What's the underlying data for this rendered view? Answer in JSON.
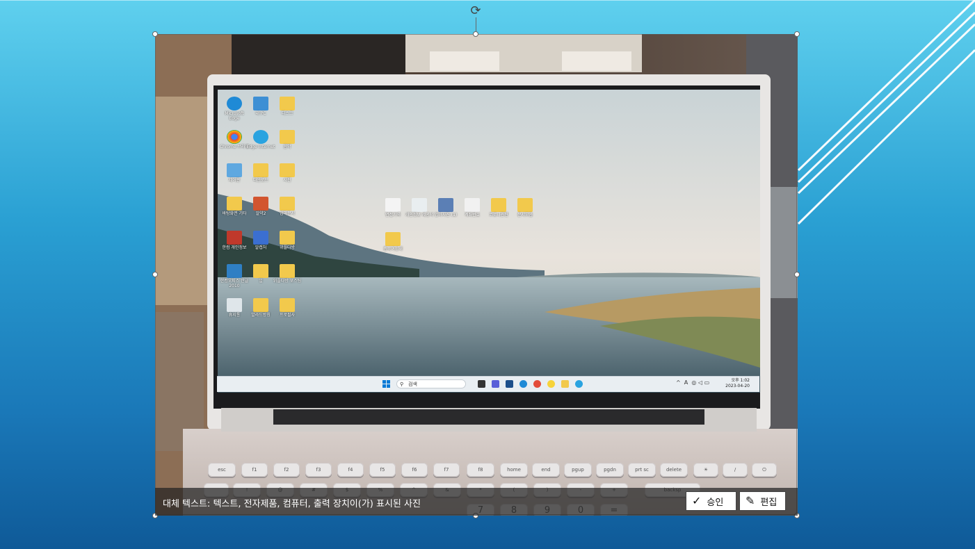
{
  "colors": {
    "slide_top": "#5fd0ee",
    "slide_bottom": "#0f5a98",
    "alt_bar": "#232323",
    "button_bg": "#ffffff"
  },
  "photo": {
    "desktop_icons": [
      {
        "label": "Microsoft Edge",
        "icon": "edge-icon"
      },
      {
        "label": "내 PC",
        "icon": "pc-icon"
      },
      {
        "label": "디스크",
        "icon": "folder-icon"
      },
      {
        "label": "Chrome 브라우",
        "icon": "chrome-icon"
      },
      {
        "label": "Edge Internet",
        "icon": "edge-icon"
      },
      {
        "label": "음악",
        "icon": "folder-icon"
      },
      {
        "label": "제어판",
        "icon": "control-icon"
      },
      {
        "label": "다운로드",
        "icon": "folder-icon"
      },
      {
        "label": "사진",
        "icon": "folder-icon"
      },
      {
        "label": "바탕화면 기타",
        "icon": "folder-icon"
      },
      {
        "label": "알약2",
        "icon": "app-icon"
      },
      {
        "label": "엄마문서",
        "icon": "folder-icon"
      },
      {
        "label": "한컴 개인정보",
        "icon": "pdf-icon"
      },
      {
        "label": "알캡처",
        "icon": "app-icon"
      },
      {
        "label": "위플다방",
        "icon": "folder-icon"
      },
      {
        "label": "한컴오피스 한글 2010",
        "icon": "hwp-icon"
      },
      {
        "label": "일",
        "icon": "folder-icon"
      },
      {
        "label": "위플다방 포스팅",
        "icon": "folder-icon"
      },
      {
        "label": "휴지통",
        "icon": "recycle-icon"
      },
      {
        "label": "발라드방칭",
        "icon": "folder-icon"
      },
      {
        "label": "프로필사",
        "icon": "folder-icon"
      }
    ],
    "center_icons": [
      {
        "label": "면접기록",
        "icon": "doc-icon"
      },
      {
        "label": "개인정보 제공서",
        "icon": "doc-icon"
      },
      {
        "label": "엄마사진 (1)",
        "icon": "photo-icon"
      },
      {
        "label": "계좌번호",
        "icon": "doc-icon"
      },
      {
        "label": "코로나관련",
        "icon": "folder-icon"
      },
      {
        "label": "문서모음",
        "icon": "folder-icon"
      },
      {
        "label": "충북여성새",
        "icon": "folder-icon"
      }
    ],
    "taskbar": {
      "search_text": "검색",
      "time": "오후 1:02",
      "date": "2023-04-20",
      "ime": "A"
    },
    "keys_row1": [
      "esc",
      "f1",
      "f2",
      "f3",
      "f4",
      "f5",
      "f6",
      "f7",
      "f8",
      "home",
      "end",
      "pgup",
      "pgdn",
      "prt sc",
      "delete",
      "☀",
      "/",
      "⏻"
    ],
    "keys_row2": [
      "",
      "!",
      "@",
      "#",
      "$",
      "%",
      "^",
      "&",
      "*",
      "(",
      ")",
      "-",
      "+",
      "backsp"
    ],
    "keys_row3": [
      "",
      "",
      "",
      "",
      "",
      "",
      "",
      "7",
      "8",
      "9",
      "0",
      "",
      "=",
      ""
    ]
  },
  "alt_text_bar": {
    "text": "대체 텍스트: 텍스트, 전자제품, 컴퓨터, 출력 장치이(가) 표시된 사진",
    "approve_label": "승인",
    "edit_label": "편집"
  }
}
